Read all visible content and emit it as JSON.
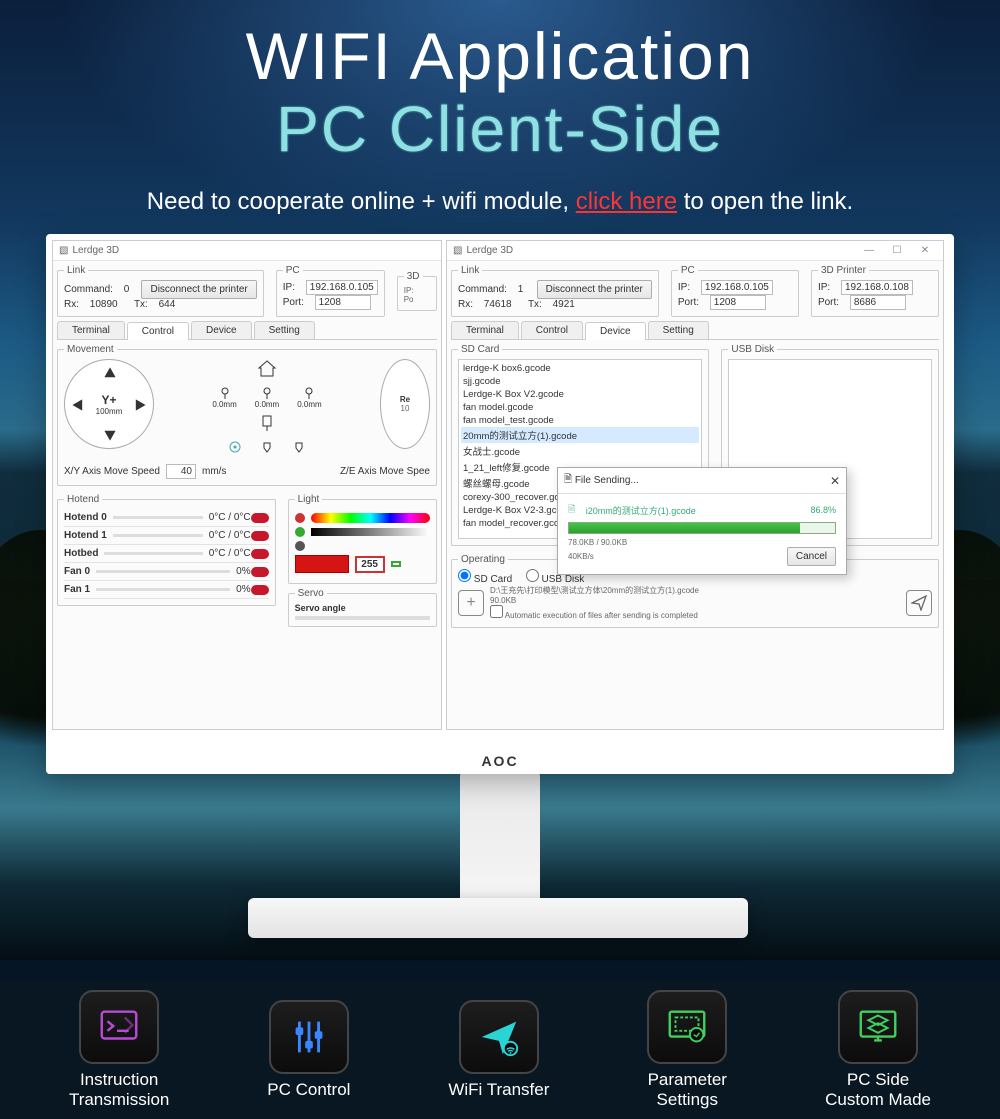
{
  "hero": {
    "title1": "WIFI Application",
    "title2": "PC Client-Side",
    "sub_pre": "Need to cooperate online + wifi module, ",
    "sub_link": "click here",
    "sub_post": " to open the link."
  },
  "monitor_brand": "AOC",
  "winA": {
    "title": "Lerdge 3D",
    "link": {
      "legend": "Link",
      "cmd_lbl": "Command:",
      "cmd": "0",
      "rx_lbl": "Rx:",
      "rx": "10890",
      "tx_lbl": "Tx:",
      "tx": "644",
      "btn": "Disconnect the printer"
    },
    "pc": {
      "legend": "PC",
      "ip_lbl": "IP:",
      "ip": "192.168.0.105",
      "port_lbl": "Port:",
      "port": "1208"
    },
    "pr": {
      "legend": "3D"
    },
    "tabs": [
      "Terminal",
      "Control",
      "Device",
      "Setting"
    ],
    "active_tab": 1,
    "movement": {
      "legend": "Movement",
      "dial_label": "Y+",
      "dial_sub": "100mm",
      "pins": [
        "0.0mm",
        "0.0mm",
        "0.0mm"
      ],
      "dial2": "Re",
      "speed_lbl": "X/Y  Axis Move Speed",
      "speed": "40",
      "speed_unit": "mm/s",
      "speed2_lbl": "Z/E  Axis Move Spee"
    },
    "hotend": {
      "legend": "Hotend",
      "rows": [
        {
          "name": "Hotend 0",
          "val": "0°C / 0°C"
        },
        {
          "name": "Hotend 1",
          "val": "0°C / 0°C"
        },
        {
          "name": "Hotbed",
          "val": "0°C / 0°C"
        },
        {
          "name": "Fan 0",
          "val": "0%"
        },
        {
          "name": "Fan 1",
          "val": "0%"
        }
      ]
    },
    "light": {
      "legend": "Light",
      "value": "255"
    },
    "servo": {
      "legend": "Servo",
      "label": "Servo angle"
    }
  },
  "winB": {
    "title": "Lerdge 3D",
    "link": {
      "legend": "Link",
      "cmd_lbl": "Command:",
      "cmd": "1",
      "rx_lbl": "Rx:",
      "rx": "74618",
      "tx_lbl": "Tx:",
      "tx": "4921",
      "btn": "Disconnect the printer"
    },
    "pc": {
      "legend": "PC",
      "ip_lbl": "IP:",
      "ip": "192.168.0.105",
      "port_lbl": "Port:",
      "port": "1208"
    },
    "pr": {
      "legend": "3D Printer",
      "ip_lbl": "IP:",
      "ip": "192.168.0.108",
      "port_lbl": "Port:",
      "port": "8686"
    },
    "tabs": [
      "Terminal",
      "Control",
      "Device",
      "Setting"
    ],
    "active_tab": 2,
    "sd": {
      "legend": "SD Card",
      "files": [
        "lerdge-K box6.gcode",
        "sjj.gcode",
        "Lerdge-K Box V2.gcode",
        "fan model.gcode",
        "fan model_test.gcode",
        "20mm的测试立方(1).gcode",
        "女战士.gcode",
        "1_21_left修复.gcode",
        "螺丝螺母.gcode",
        "corexy-300_recover.gcode",
        "Lerdge-K Box V2-3.gcode",
        "fan model_recover.gcode"
      ],
      "sel_index": 5
    },
    "usb": {
      "legend": "USB Disk"
    },
    "modal": {
      "title": "File Sending...",
      "filename": "i20mm的测试立方(1).gcode",
      "pct": "86.8%",
      "pct_num": 86.8,
      "stat": "78.0KB / 90.0KB",
      "rate": "40KB/s",
      "cancel": "Cancel"
    },
    "op": {
      "legend": "Operating",
      "radio_sd": "SD Card",
      "radio_usb": "USB Disk",
      "path": "D:\\王充先\\打印模型\\测试立方体\\20mm的测试立方(1).gcode",
      "size": "90.0KB",
      "auto": "Automatic execution of files after sending is completed"
    }
  },
  "features": [
    {
      "l1": "Instruction",
      "l2": "Transmission",
      "color": "#b94bd8"
    },
    {
      "l1": "PC Control",
      "l2": "",
      "color": "#3a86ff"
    },
    {
      "l1": "WiFi Transfer",
      "l2": "",
      "color": "#2bd4d4"
    },
    {
      "l1": "Parameter",
      "l2": "Settings",
      "color": "#40d060"
    },
    {
      "l1": "PC Side",
      "l2": "Custom Made",
      "color": "#40d060"
    }
  ]
}
